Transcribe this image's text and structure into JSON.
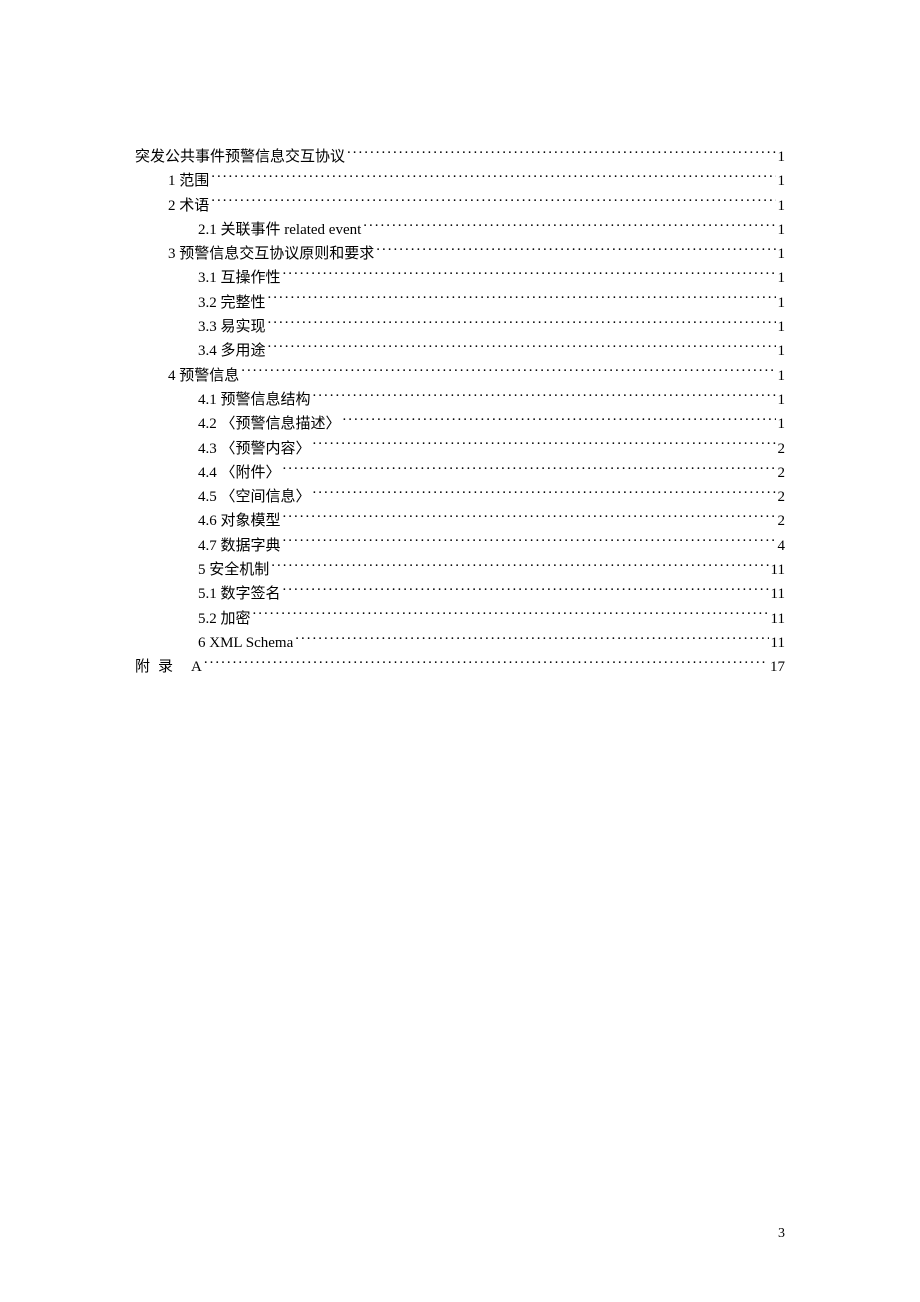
{
  "toc": {
    "title": {
      "label": "突发公共事件预警信息交互协议",
      "page": "1",
      "indent": 0
    },
    "entries": [
      {
        "label": "1 范围 ",
        "page": "1",
        "indent": 1
      },
      {
        "label": "2 术语 ",
        "page": "1",
        "indent": 1
      },
      {
        "label": "2.1 关联事件 related event ",
        "page": "1",
        "indent": 2
      },
      {
        "label": "3 预警信息交互协议原则和要求 ",
        "page": "1",
        "indent": 1
      },
      {
        "label": "3.1 互操作性 ",
        "page": "1",
        "indent": 2
      },
      {
        "label": "3.2 完整性 ",
        "page": "1",
        "indent": 2
      },
      {
        "label": "3.3 易实现 ",
        "page": "1",
        "indent": 2
      },
      {
        "label": "3.4 多用途 ",
        "page": "1",
        "indent": 2
      },
      {
        "label": "4 预警信息 ",
        "page": "1",
        "indent": 1
      },
      {
        "label": "4.1 预警信息结构 ",
        "page": "1",
        "indent": 2
      },
      {
        "label": "4.2 〈预警信息描述〉 ",
        "page": "1",
        "indent": 2
      },
      {
        "label": "4.3 〈预警内容〉 ",
        "page": "2",
        "indent": 2
      },
      {
        "label": "4.4 〈附件〉 ",
        "page": "2",
        "indent": 2
      },
      {
        "label": "4.5 〈空间信息〉 ",
        "page": "2",
        "indent": 2
      },
      {
        "label": "4.6 对象模型 ",
        "page": "2",
        "indent": 2
      },
      {
        "label": "4.7 数据字典 ",
        "page": "4",
        "indent": 2
      },
      {
        "label": "5 安全机制 ",
        "page": "11",
        "indent": 2
      },
      {
        "label": "5.1 数字签名 ",
        "page": "11",
        "indent": 2
      },
      {
        "label": "5.2 加密 ",
        "page": "11",
        "indent": 2
      },
      {
        "label": "6 XML Schema ",
        "page": "11",
        "indent": 2
      }
    ],
    "appendix": {
      "prefix": "附录",
      "label": "A",
      "page": "17"
    }
  },
  "pageNumber": "3"
}
